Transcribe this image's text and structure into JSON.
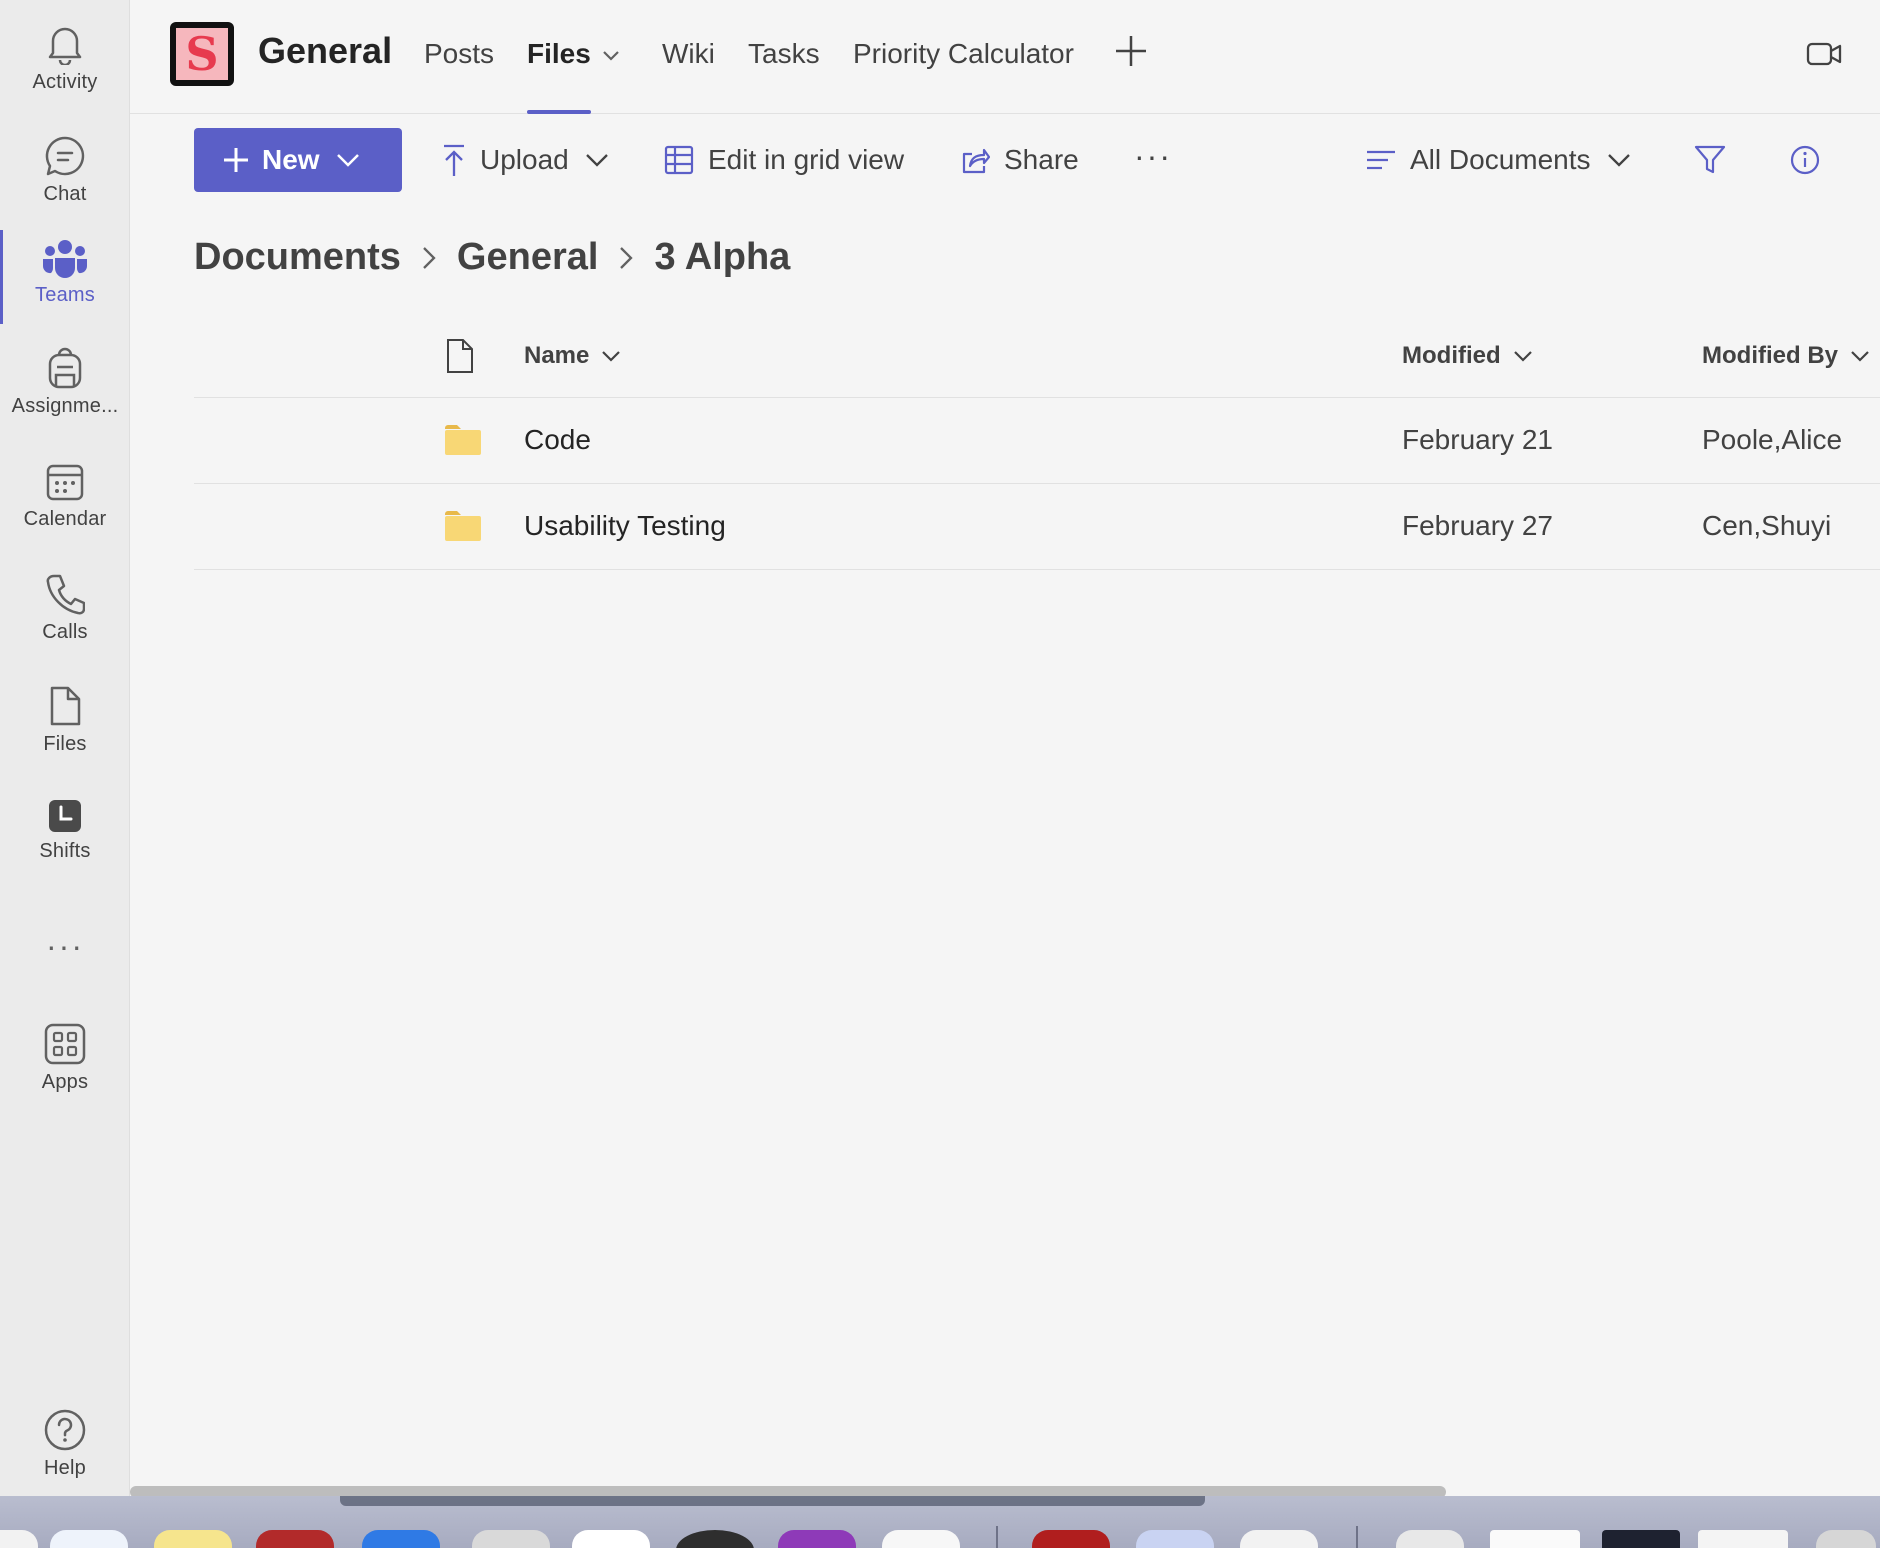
{
  "rail": {
    "items": [
      {
        "label": "Activity",
        "icon": "bell-icon"
      },
      {
        "label": "Chat",
        "icon": "chat-icon"
      },
      {
        "label": "Teams",
        "icon": "teams-icon",
        "active": true
      },
      {
        "label": "Assignme...",
        "icon": "backpack-icon"
      },
      {
        "label": "Calendar",
        "icon": "calendar-icon"
      },
      {
        "label": "Calls",
        "icon": "phone-icon"
      },
      {
        "label": "Files",
        "icon": "file-icon"
      },
      {
        "label": "Shifts",
        "icon": "clock-icon"
      },
      {
        "label": "Help",
        "icon": "help-icon"
      },
      {
        "label": "Apps",
        "icon": "apps-icon"
      }
    ],
    "more_label": "···"
  },
  "header": {
    "team_logo_letter": "S",
    "channel_title": "General",
    "tabs": [
      {
        "label": "Posts"
      },
      {
        "label": "Files",
        "active": true
      },
      {
        "label": "Wiki"
      },
      {
        "label": "Tasks"
      },
      {
        "label": "Priority Calculator"
      }
    ]
  },
  "toolbar": {
    "new_label": "New",
    "upload_label": "Upload",
    "grid_label": "Edit in grid view",
    "share_label": "Share",
    "more_label": "···",
    "view_label": "All Documents"
  },
  "breadcrumb": {
    "items": [
      "Documents",
      "General",
      "3 Alpha"
    ]
  },
  "table": {
    "columns": {
      "name": "Name",
      "modified": "Modified",
      "modified_by": "Modified By"
    },
    "rows": [
      {
        "name": "Code",
        "modified": "February 21",
        "modified_by": "Poole,Alice"
      },
      {
        "name": "Usability Testing",
        "modified": "February 27",
        "modified_by": "Cen,Shuyi"
      }
    ]
  },
  "colors": {
    "accent": "#5b5fc7",
    "folder": "#f8d775"
  }
}
